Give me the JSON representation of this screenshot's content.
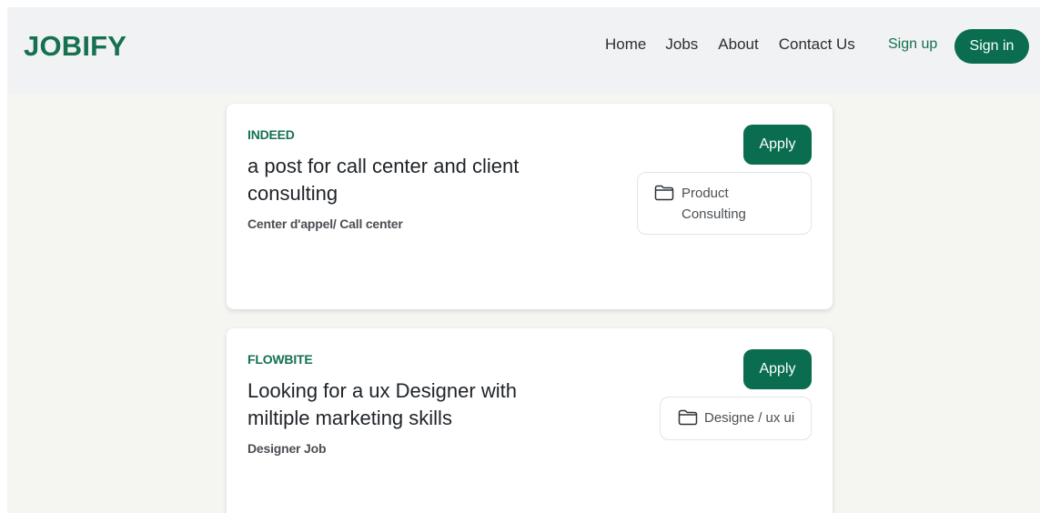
{
  "header": {
    "logo": "JOBIFY",
    "nav": {
      "home": "Home",
      "jobs": "Jobs",
      "about": "About",
      "contact": "Contact Us"
    },
    "signup": "Sign up",
    "signin": "Sign in"
  },
  "jobs": [
    {
      "company": "INDEED",
      "title": "a post for call center and client consulting",
      "subtitle": "Center d'appel/ Call center",
      "apply": "Apply",
      "category_icon": "folder-icon",
      "category": "Product Consulting"
    },
    {
      "company": "FLOWBITE",
      "title": "Looking for a ux Designer with miltiple marketing skills",
      "subtitle": "Designer Job",
      "apply": "Apply",
      "category_icon": "folder-icon",
      "category": "Designe / ux ui"
    }
  ],
  "colors": {
    "brand_green": "#0a6d4f",
    "page_background": "#f5f6f1",
    "nav_background": "#f1f2f3"
  }
}
